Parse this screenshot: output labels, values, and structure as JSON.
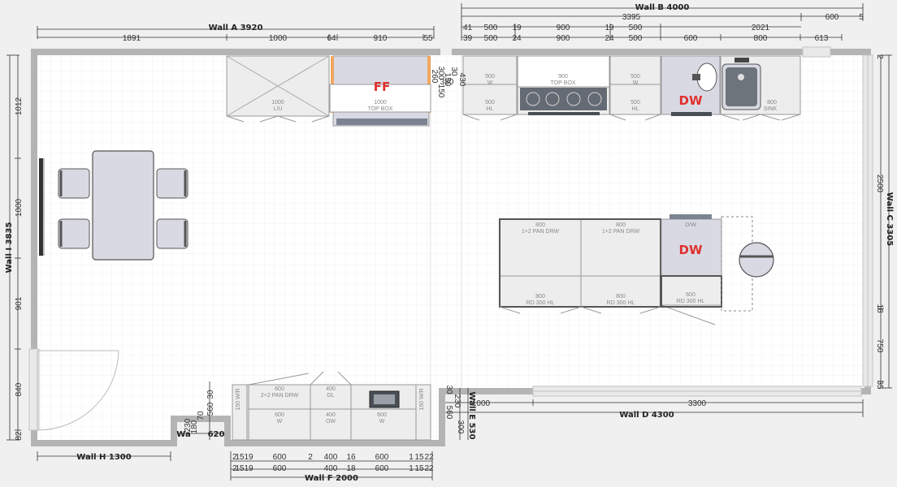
{
  "walls": {
    "a": "Wall A  3920",
    "b": "Wall B  4000",
    "c": "Wall C  3305",
    "d": "Wall D  4300",
    "e": "Wall E  530",
    "f": "Wall F  2000",
    "h": "Wall H  1300",
    "i": "Wall I  3835",
    "wa": "Wa"
  },
  "dims": {
    "a1": "1891",
    "a2": "1000",
    "a3": "64",
    "a4": "910",
    "a5": "55",
    "b_total": "3395",
    "b_600": "600",
    "b_5": "5",
    "b1": [
      "41",
      "500",
      "19",
      "900",
      "19",
      "500",
      "2021"
    ],
    "b2": [
      "39",
      "500",
      "24",
      "900",
      "24",
      "500",
      "600",
      "800",
      "613"
    ],
    "i1": "1012",
    "i2": "1000",
    "i3": "901",
    "i4": "840",
    "i5": "82",
    "c1": "2500",
    "c2": "18",
    "c3": "750",
    "c4": "35",
    "c5": "2",
    "d1": "1000",
    "d2": "3300",
    "e1": "30",
    "e2": "230",
    "e3": "560",
    "e4": "300",
    "f1": [
      "2",
      "15",
      "19",
      "600",
      "2",
      "400",
      "16",
      "600",
      "1",
      "15",
      "22"
    ],
    "f2": [
      "2",
      "15",
      "19",
      "600",
      "400",
      "18",
      "600",
      "1",
      "15",
      "22"
    ],
    "f_620": "620",
    "small_left": [
      "230",
      "180",
      "70",
      "560",
      "30"
    ],
    "gap": [
      "260",
      "300",
      "150",
      "150",
      "380",
      "30",
      "430"
    ]
  },
  "tags": {
    "ff": "FF",
    "dw1": "DW",
    "dw2": "DW"
  },
  "units": {
    "wall_a_1": {
      "size": "1000",
      "name": "L/U"
    },
    "wall_a_2": {
      "size": "1000",
      "name": "TOP BOX"
    },
    "b_w1": {
      "size": "500",
      "name": "W"
    },
    "b_top": {
      "size": "900",
      "name": "TOP BOX"
    },
    "b_w2": {
      "size": "500",
      "name": "W"
    },
    "b_hl1": {
      "size": "500",
      "name": "HL"
    },
    "b_hl2": {
      "size": "500",
      "name": "HL"
    },
    "b_sink": {
      "size": "800",
      "name": "SINK"
    },
    "isl_1": {
      "size": "800",
      "name": "1+2 PAN DRW"
    },
    "isl_2": {
      "size": "800",
      "name": "1+2 PAN DRW"
    },
    "isl_3": {
      "size": "800",
      "name": "RD 300 HL"
    },
    "isl_4": {
      "size": "800",
      "name": "RD 300 HL"
    },
    "isl_dw": {
      "name": "D/W"
    },
    "isl_6": {
      "size": "600",
      "name": "RD 300 HL"
    },
    "f_1": {
      "size": "600",
      "name": "2+2 PAN DRW"
    },
    "f_2": {
      "size": "400",
      "name": "DL"
    },
    "f_3": {
      "size": "600",
      "name": "W"
    },
    "f_4": {
      "size": "400",
      "name": "OW"
    },
    "f_5": {
      "size": "600",
      "name": "W"
    },
    "f_side": "150 W/R",
    "f_side2": "150 W/R"
  },
  "colors": {
    "wall": "#b4b4b4",
    "floor": "#ffffff",
    "grid": "#e6e6e6",
    "cabinet": "#ededed",
    "appliance": "#d8d9e3",
    "tag": "#e0312d"
  }
}
